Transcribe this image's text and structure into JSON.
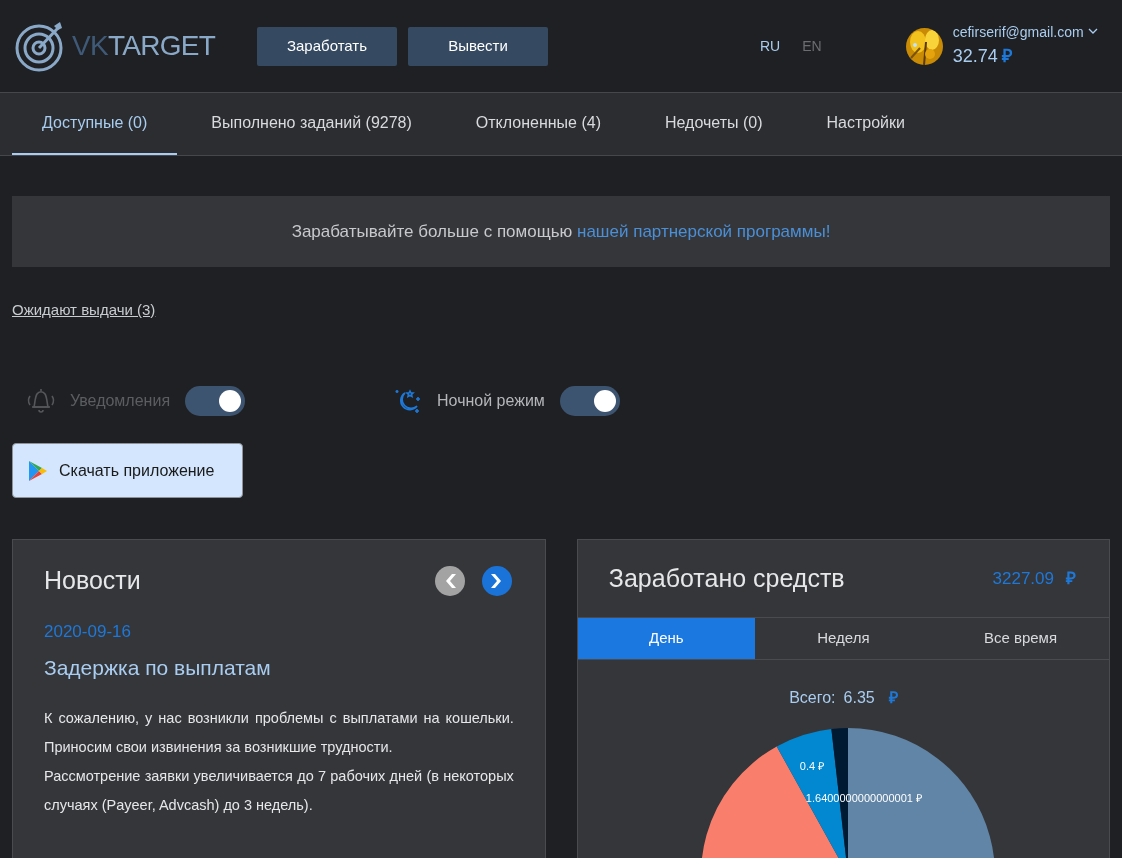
{
  "header": {
    "logo": {
      "prefix": "VK",
      "suffix": "TARGET"
    },
    "buttons": [
      "Заработать",
      "Вывести"
    ],
    "languages": [
      {
        "label": "RU",
        "selected": true
      },
      {
        "label": "EN",
        "selected": false
      }
    ],
    "user": {
      "email": "cefirserif@gmail.com",
      "balance": "32.74",
      "currency": "₽"
    }
  },
  "tabs": [
    {
      "label": "Доступные (0)",
      "selected": true
    },
    {
      "label": "Выполнено заданий (9278)",
      "selected": false
    },
    {
      "label": "Отклоненные (4)",
      "selected": false
    },
    {
      "label": "Недочеты (0)",
      "selected": false
    },
    {
      "label": "Настройки",
      "selected": false
    }
  ],
  "banner": {
    "text": "Зарабатывайте больше с помощью ",
    "link": "нашей партнерской программы!"
  },
  "pending_link": "Ожидают выдачи (3)",
  "toggles": [
    {
      "kind": "bell",
      "label": "Уведомления",
      "on": true,
      "disabled": true
    },
    {
      "kind": "moon",
      "label": "Ночной режим",
      "on": true,
      "disabled": false
    }
  ],
  "app_button": "Скачать приложение",
  "news": {
    "title": "Новости",
    "date": "2020-09-16",
    "headline": "Задержка по выплатам",
    "paragraphs": [
      "К сожалению, у нас возникли проблемы с выплатами на кошельки. Приносим свои извинения за возникшие трудности.",
      "Рассмотрение заявки увеличивается до 7 рабочих дней (в некоторых случаях (Payeer, Advcash) до 3 недель)."
    ]
  },
  "earnings": {
    "title": "Заработано средств",
    "total": "3227.09",
    "currency": "₽",
    "periods": [
      {
        "label": "День",
        "selected": true
      },
      {
        "label": "Неделя",
        "selected": false
      },
      {
        "label": "Все время",
        "selected": false
      }
    ],
    "sum_label": "Всего:",
    "sum": "6.35",
    "sum_currency": "₽",
    "pie_labels": [
      "0.4 ₽",
      "1.6400000000000001 ₽"
    ]
  }
}
